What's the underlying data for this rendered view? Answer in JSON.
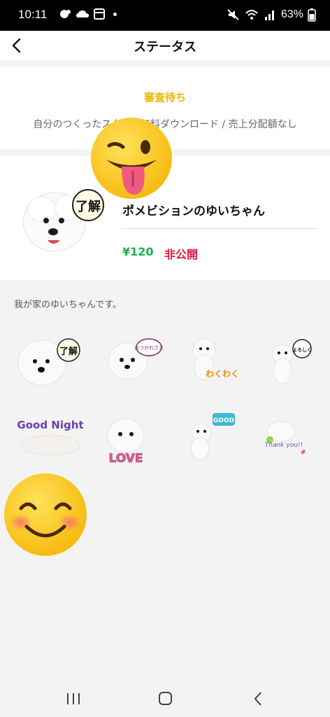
{
  "status_bar": {
    "time": "10:11",
    "battery": "63%"
  },
  "header": {
    "title": "ステータス",
    "back_icon": "back-arrow-icon"
  },
  "review": {
    "status_label": "審査待ち",
    "description": "自分のつくったスタンプ無料ダウンロード / 売上分配額なし"
  },
  "package": {
    "name": "ポメビションのゆいちゃん",
    "price": "¥120",
    "visibility": "非公開",
    "description": "我が家のゆいちゃんです。",
    "main_sticker_text": "了解"
  },
  "stickers": [
    {
      "id": "sticker-ryokai",
      "text": "了解"
    },
    {
      "id": "sticker-otsukaresama",
      "text": "おつかれさま"
    },
    {
      "id": "sticker-wakuwaku",
      "text": "わくわく"
    },
    {
      "id": "sticker-yoroshiku",
      "text": "よろしく"
    },
    {
      "id": "sticker-goodnight",
      "text": "Good Night"
    },
    {
      "id": "sticker-love",
      "text": "LOVE"
    },
    {
      "id": "sticker-good",
      "text": "GOOD"
    },
    {
      "id": "sticker-thankyou",
      "text": "Thank you!!"
    }
  ],
  "colors": {
    "pending": "#f0b400",
    "price": "#19b34e",
    "private": "#e0143c"
  }
}
